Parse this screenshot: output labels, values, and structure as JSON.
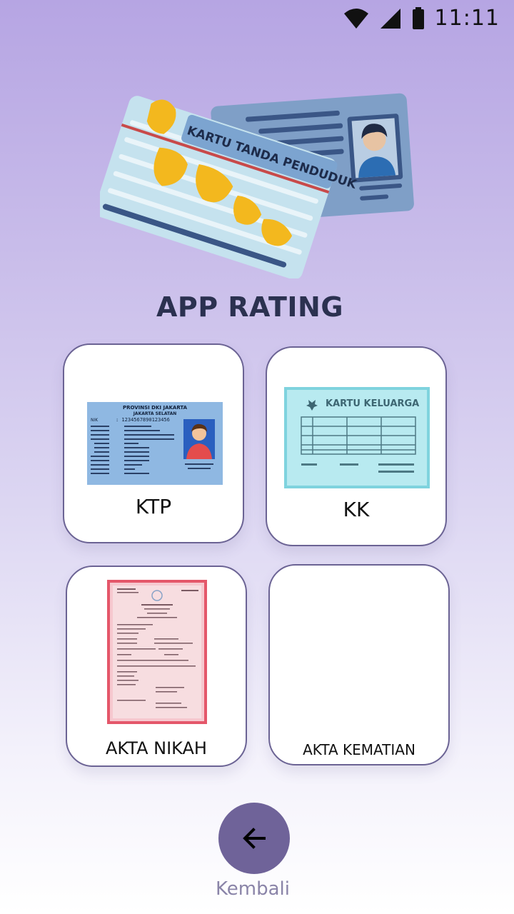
{
  "status_bar": {
    "time": "11:11",
    "icons": [
      "wifi-icon",
      "signal-icon",
      "battery-icon"
    ]
  },
  "hero": {
    "card_text": "KARTU TANDA PENDUDUK"
  },
  "title": "APP RATING",
  "cards": [
    {
      "label": "KTP",
      "image_text": {
        "province": "PROVINSI DKI JAKARTA",
        "city": "JAKARTA SELATAN",
        "nik_label": "NIK",
        "nik": ": 1234567890123456"
      }
    },
    {
      "label": "KK",
      "image_text": {
        "title": "KARTU KELUARGA"
      }
    },
    {
      "label": "AKTA NIKAH"
    },
    {
      "label": "AKTA KEMATIAN"
    }
  ],
  "back": {
    "label": "Kembali",
    "icon": "arrow-left-icon"
  },
  "colors": {
    "accent": "#6f6399",
    "title": "#2b3150",
    "card_border": "#6b6394"
  }
}
